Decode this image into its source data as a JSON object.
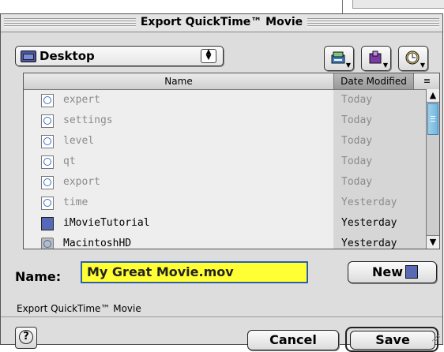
{
  "dialog": {
    "title": "Export QuickTime™ Movie",
    "location": "Desktop",
    "columns": {
      "name": "Name",
      "date": "Date Modified",
      "sort_glyph": "≡"
    },
    "toolbar_icons": [
      "disk-icon",
      "favorites-icon",
      "recent-icon"
    ],
    "files": [
      {
        "name": "expert",
        "date": "Today",
        "enabled": false,
        "icon": "document-icon"
      },
      {
        "name": "settings",
        "date": "Today",
        "enabled": false,
        "icon": "document-icon"
      },
      {
        "name": "level",
        "date": "Today",
        "enabled": false,
        "icon": "document-icon"
      },
      {
        "name": "qt",
        "date": "Today",
        "enabled": false,
        "icon": "document-icon"
      },
      {
        "name": "export",
        "date": "Today",
        "enabled": false,
        "icon": "document-icon"
      },
      {
        "name": "time",
        "date": "Yesterday",
        "enabled": false,
        "icon": "document-icon"
      },
      {
        "name": "iMovieTutorial",
        "date": "Yesterday",
        "enabled": true,
        "icon": "folder-icon"
      },
      {
        "name": "MacintoshHD",
        "date": "Yesterday",
        "enabled": true,
        "icon": "disk-icon"
      }
    ],
    "name_label": "Name:",
    "name_value": "My Great Movie.mov",
    "new_label": "New",
    "format_label": "Export QuickTime™ Movie",
    "help_glyph": "?",
    "cancel_label": "Cancel",
    "save_label": "Save"
  }
}
